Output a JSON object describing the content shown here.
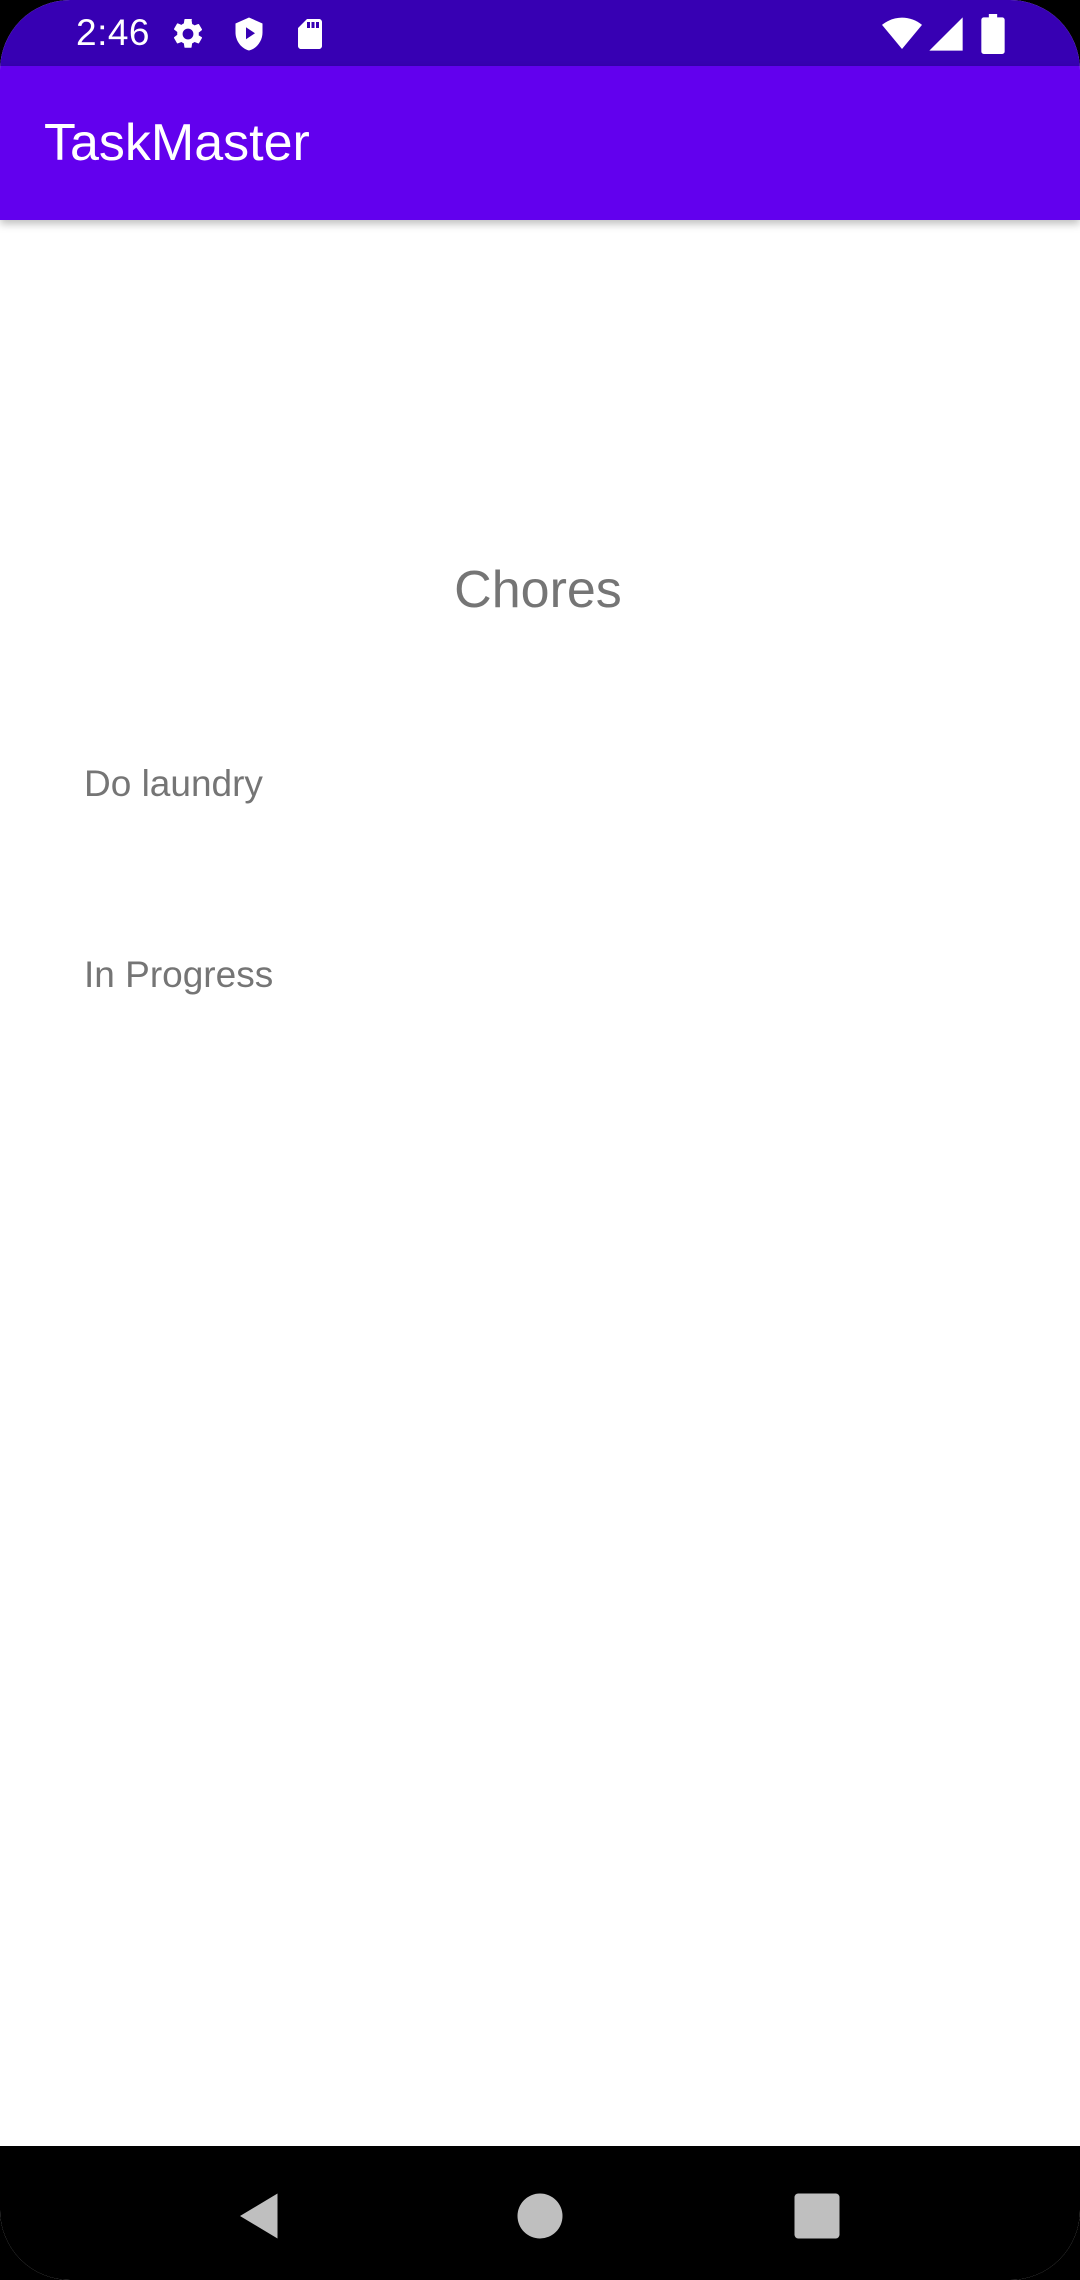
{
  "status_bar": {
    "time": "2:46",
    "icons_left": [
      "settings-icon",
      "play-protect-icon",
      "sd-card-icon"
    ],
    "icons_right": [
      "wifi-icon",
      "signal-icon",
      "battery-icon"
    ],
    "background": "#3700b3"
  },
  "app_bar": {
    "title": "TaskMaster",
    "background": "#6200ee"
  },
  "task": {
    "title": "Chores",
    "body": "Do laundry",
    "state": "In Progress"
  },
  "nav_bar": {
    "buttons": [
      "back-icon",
      "home-icon",
      "recents-icon"
    ]
  }
}
